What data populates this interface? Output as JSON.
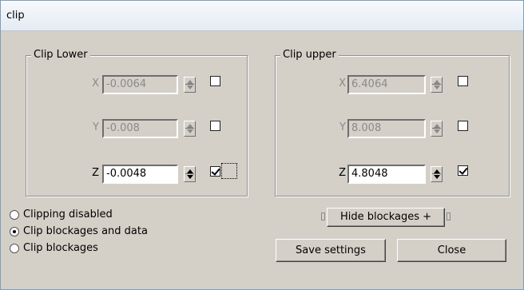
{
  "window": {
    "title": "clip"
  },
  "clip_lower": {
    "title": "Clip Lower",
    "rows": [
      {
        "axis": "X",
        "value": "-0.0064",
        "enabled": false,
        "checked": false
      },
      {
        "axis": "Y",
        "value": "-0.008",
        "enabled": false,
        "checked": false
      },
      {
        "axis": "Z",
        "value": "-0.0048",
        "enabled": true,
        "checked": true
      }
    ]
  },
  "clip_upper": {
    "title": "Clip upper",
    "rows": [
      {
        "axis": "X",
        "value": "6.4064",
        "enabled": false,
        "checked": false
      },
      {
        "axis": "Y",
        "value": "8.008",
        "enabled": false,
        "checked": false
      },
      {
        "axis": "Z",
        "value": "4.8048",
        "enabled": true,
        "checked": true
      }
    ]
  },
  "clip_mode": {
    "options": [
      {
        "label": "Clipping disabled",
        "selected": false
      },
      {
        "label": "Clip blockages and data",
        "selected": true
      },
      {
        "label": "Clip blockages",
        "selected": false
      }
    ]
  },
  "buttons": {
    "hide_blockages": "Hide blockages +",
    "save_settings": "Save settings",
    "close": "Close"
  },
  "colors": {
    "dialog_background": "#d4d0c8",
    "disabled_text": "#8a8a8a",
    "title_bar": "#e4ebf4"
  }
}
